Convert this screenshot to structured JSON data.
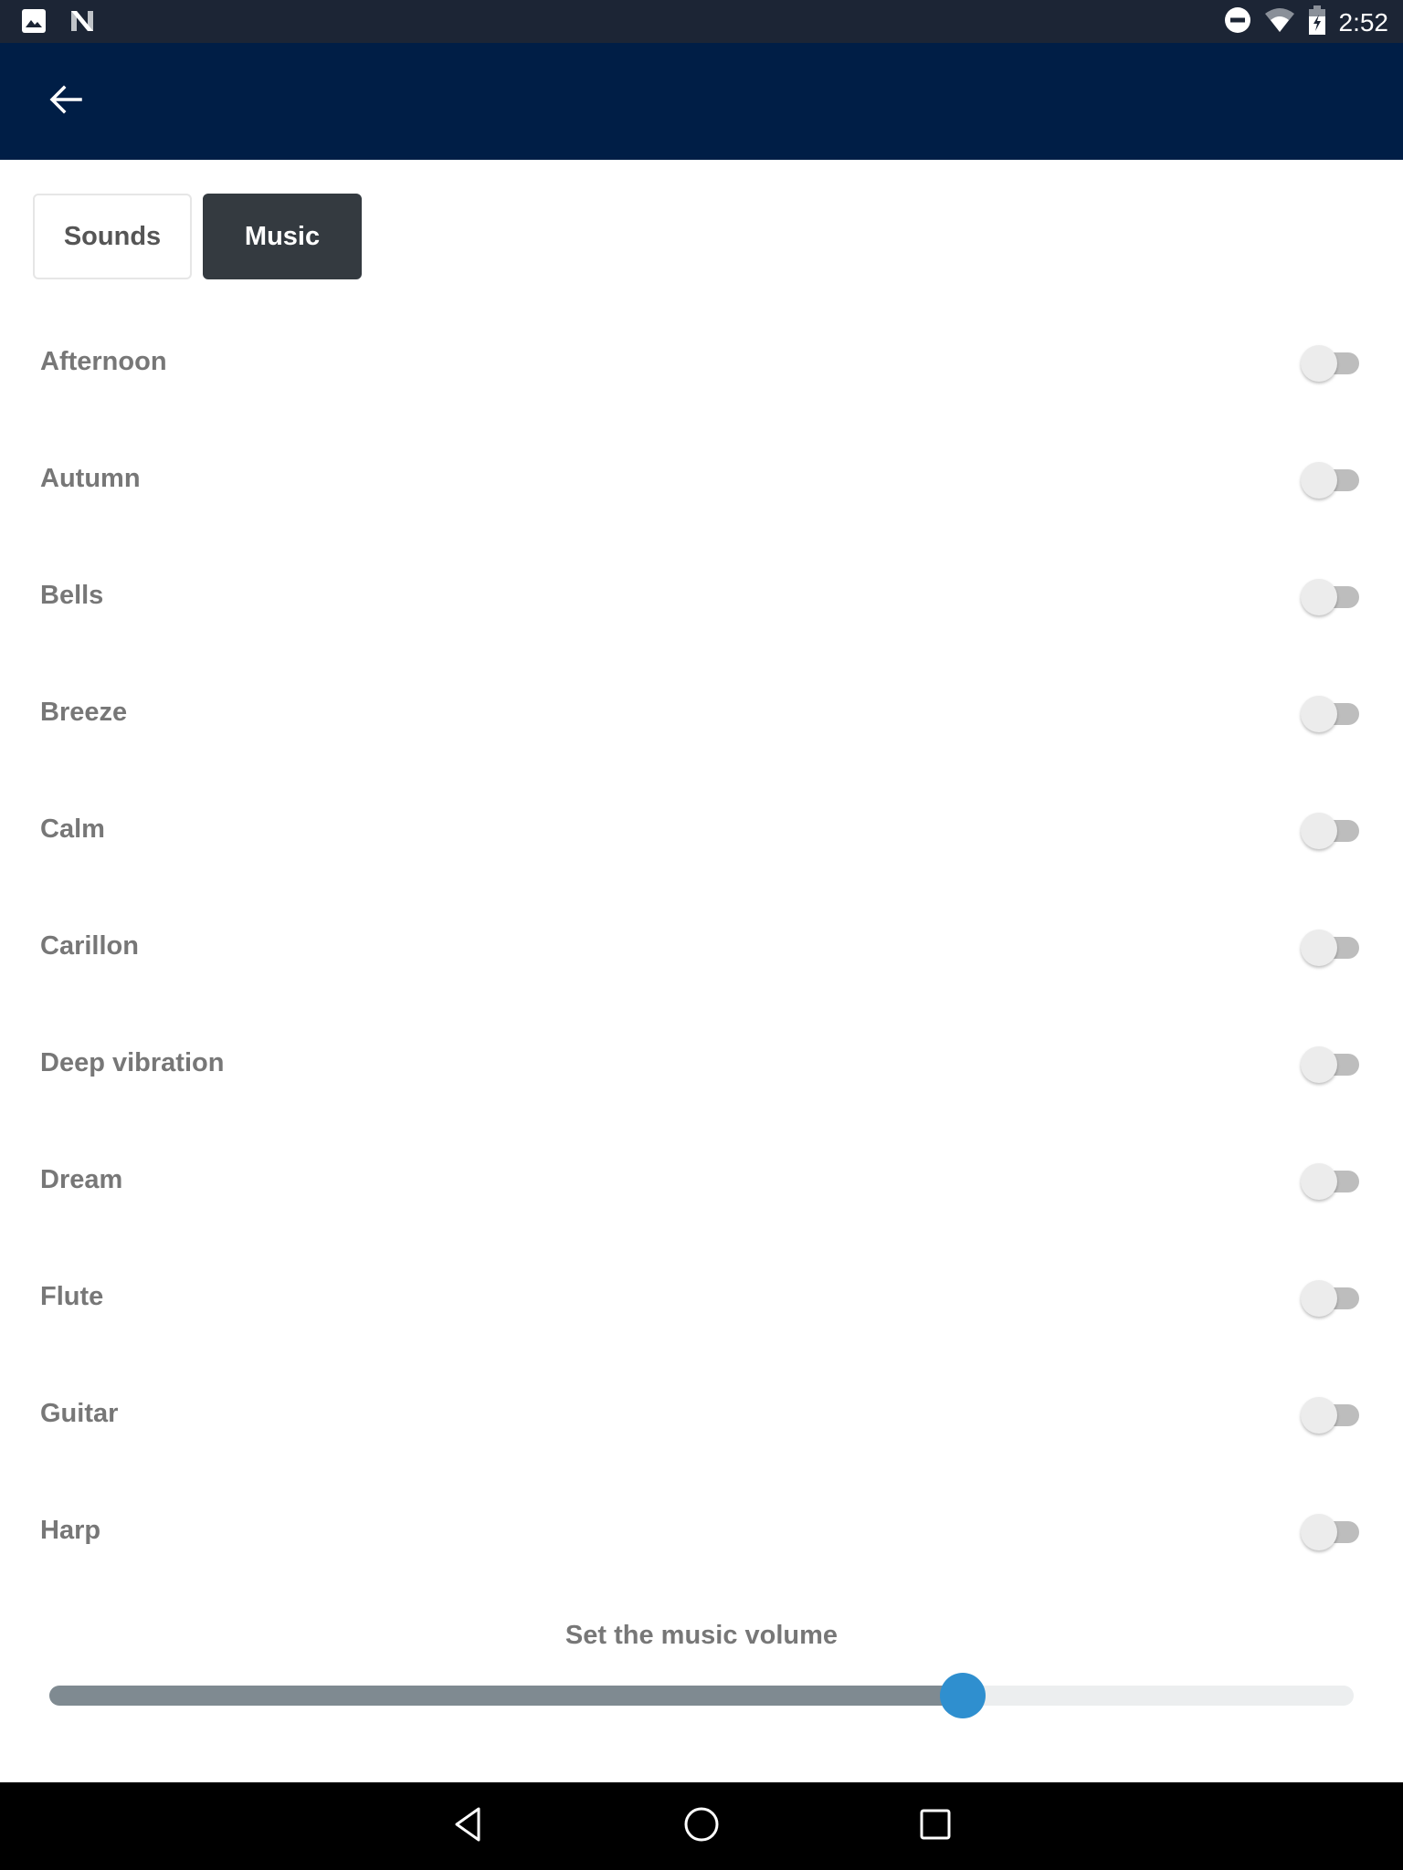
{
  "status_bar": {
    "time": "2:52",
    "left_icons": [
      "image-icon",
      "n-logo-icon"
    ],
    "right_icons": [
      "do-not-disturb-icon",
      "wifi-icon",
      "battery-charging-icon"
    ]
  },
  "app_bar": {
    "back_icon": "arrow-left-icon"
  },
  "tabs": [
    {
      "label": "Sounds",
      "active": false
    },
    {
      "label": "Music",
      "active": true
    }
  ],
  "music_list": [
    {
      "label": "Afternoon",
      "enabled": false
    },
    {
      "label": "Autumn",
      "enabled": false
    },
    {
      "label": "Bells",
      "enabled": false
    },
    {
      "label": "Breeze",
      "enabled": false
    },
    {
      "label": "Calm",
      "enabled": false
    },
    {
      "label": "Carillon",
      "enabled": false
    },
    {
      "label": "Deep vibration",
      "enabled": false
    },
    {
      "label": "Dream",
      "enabled": false
    },
    {
      "label": "Flute",
      "enabled": false
    },
    {
      "label": "Guitar",
      "enabled": false
    },
    {
      "label": "Harp",
      "enabled": false
    }
  ],
  "volume": {
    "label": "Set the music volume",
    "value_fraction": 0.7,
    "colors": {
      "fill": "#7f8a91",
      "rail": "#eceeef",
      "knob": "#2f8fcf"
    }
  },
  "nav_bar": {
    "buttons": [
      "back-triangle-icon",
      "home-circle-icon",
      "recents-square-icon"
    ]
  }
}
